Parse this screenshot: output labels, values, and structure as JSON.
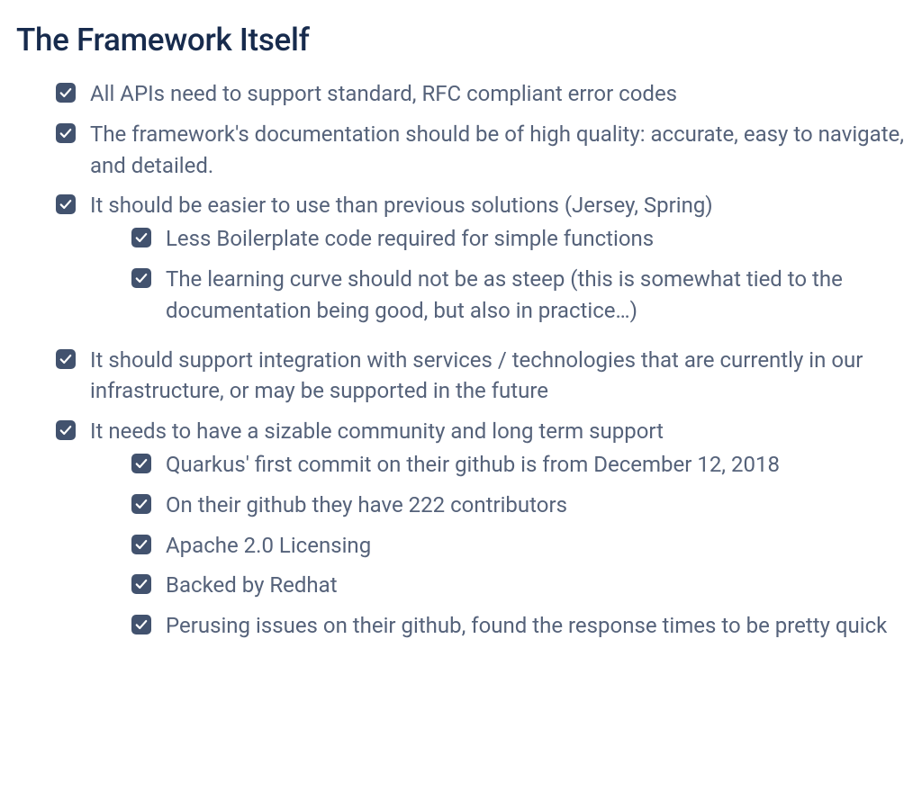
{
  "heading": "The Framework Itself",
  "items": [
    {
      "text": "All APIs need to support standard, RFC compliant error codes",
      "checked": true
    },
    {
      "text": "The framework's documentation should be of high quality: accurate, easy to navigate, and detailed.",
      "checked": true
    },
    {
      "text": "It should be easier to use than previous solutions (Jersey, Spring)",
      "checked": true,
      "children": [
        {
          "text": "Less Boilerplate code required for simple functions",
          "checked": true
        },
        {
          "text": "The learning curve should not be as steep (this is somewhat tied to the documentation being good, but also in practice…)",
          "checked": true
        }
      ]
    },
    {
      "text": "It should support integration with services / technologies that are currently in our infrastructure, or may be supported in the future",
      "checked": true
    },
    {
      "text": "It needs to have a sizable community and long term support",
      "checked": true,
      "children": [
        {
          "text": "Quarkus' first commit on their github is from December 12, 2018",
          "checked": true
        },
        {
          "text": "On their github they have 222 contributors",
          "checked": true
        },
        {
          "text": "Apache 2.0 Licensing",
          "checked": true
        },
        {
          "text": "Backed by Redhat",
          "checked": true
        },
        {
          "text": "Perusing issues on their github, found the response times to be pretty quick",
          "checked": true
        }
      ]
    }
  ]
}
